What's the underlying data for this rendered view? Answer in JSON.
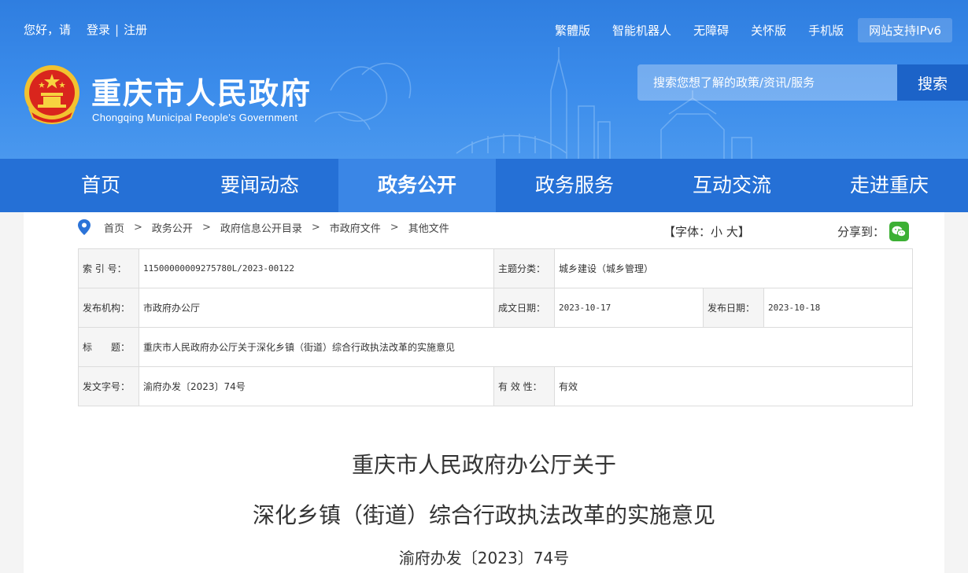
{
  "topbar": {
    "greeting": "您好，请",
    "login": "登录",
    "separator": "|",
    "register": "注册",
    "links": [
      "繁體版",
      "智能机器人",
      "无障碍",
      "关怀版",
      "手机版"
    ],
    "ipv6": "网站支持IPv6"
  },
  "brand": {
    "title": "重庆市人民政府",
    "subtitle": "Chongqing Municipal People's Government"
  },
  "search": {
    "placeholder": "搜索您想了解的政策/资讯/服务",
    "button": "搜索"
  },
  "nav": {
    "items": [
      "首页",
      "要闻动态",
      "政务公开",
      "政务服务",
      "互动交流",
      "走进重庆"
    ],
    "active": "政务公开"
  },
  "breadcrumb": [
    "首页",
    "政务公开",
    "政府信息公开目录",
    "市政府文件",
    "其他文件"
  ],
  "breadcrumb_arrow": ">",
  "font_size": {
    "open": "【字体：",
    "small": "小",
    "large": "大",
    "close": "】"
  },
  "share_label": "分享到：",
  "info": {
    "index_label": "索 引 号：",
    "index_value": "11500000009275780L/2023-00122",
    "topic_label": "主题分类：",
    "topic_value": "城乡建设（城乡管理）",
    "issuer_label": "发布机构：",
    "issuer_value": "市政府办公厅",
    "written_label": "成文日期：",
    "written_value": "2023-10-17",
    "published_label": "发布日期：",
    "published_value": "2023-10-18",
    "title_label": "标　　题：",
    "title_value": "重庆市人民政府办公厅关于深化乡镇（街道）综合行政执法改革的实施意见",
    "docno_label": "发文字号：",
    "docno_value": "渝府办发〔2023〕74号",
    "validity_label": "有 效 性：",
    "validity_value": "有效"
  },
  "document": {
    "title_line1": "重庆市人民政府办公厅关于",
    "title_line2": "深化乡镇（街道）综合行政执法改革的实施意见",
    "number": "渝府办发〔2023〕74号"
  },
  "colors": {
    "header": "#3b8ceb",
    "nav": "#2570d6",
    "nav_active": "#3a86e6",
    "search_button": "#1c63c8",
    "wechat": "#3cb034"
  }
}
